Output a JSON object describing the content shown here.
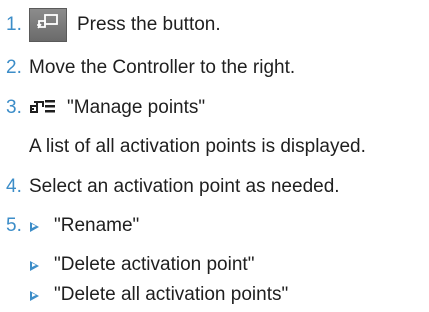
{
  "steps": [
    {
      "number": "1.",
      "text": "Press the button.",
      "icon": "activation-point-button-icon"
    },
    {
      "number": "2.",
      "text": "Move the Controller to the right."
    },
    {
      "number": "3.",
      "text": "\"Manage points\"",
      "icon": "manage-points-icon"
    },
    {
      "note": "A list of all activation points is displayed."
    },
    {
      "number": "4.",
      "text": "Select an activation point as needed."
    },
    {
      "number": "5.",
      "text": "\"Rename\"",
      "icon": "arrow-right-triangle-icon"
    }
  ],
  "sub_options": [
    {
      "text": "\"Delete activation point\"",
      "icon": "arrow-right-triangle-icon"
    },
    {
      "text": "\"Delete all activation points\"",
      "icon": "arrow-right-triangle-icon"
    }
  ],
  "colors": {
    "accent": "#3c8dc8",
    "text": "#1f1f1f",
    "button_bg": "#7a7a7a"
  }
}
